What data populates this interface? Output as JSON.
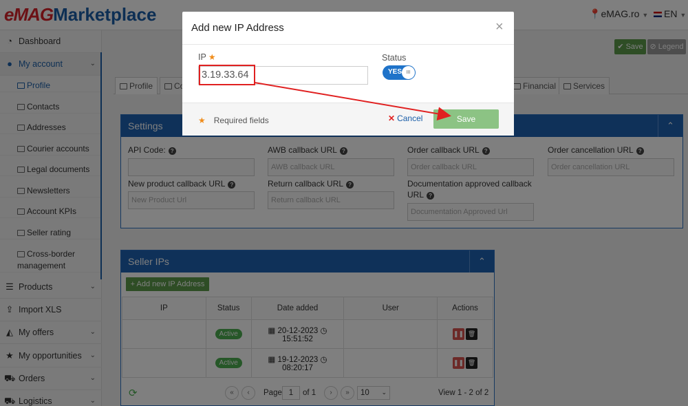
{
  "header": {
    "logo_brand": "eMAG",
    "logo_suffix": "Marketplace",
    "domain": "eMAG.ro",
    "language": "EN"
  },
  "sidebar": {
    "dashboard": "Dashboard",
    "my_account": "My account",
    "sub_items": [
      "Profile",
      "Contacts",
      "Addresses",
      "Courier accounts",
      "Legal documents",
      "Newsletters",
      "Account KPIs",
      "Seller rating",
      "Cross-border",
      "management"
    ],
    "products": "Products",
    "import_xls": "Import XLS",
    "my_offers": "My offers",
    "my_opportunities": "My opportunities",
    "orders": "Orders",
    "logistics": "Logistics"
  },
  "toolbar": {
    "save": "Save",
    "legend": "Legend"
  },
  "tabs": {
    "profile": "Profile",
    "co": "Co",
    "financial": "Financial",
    "services": "Services"
  },
  "settings": {
    "title": "Settings",
    "labels": {
      "api_code": "API Code:",
      "awb_callback": "AWB callback URL",
      "order_callback": "Order callback URL",
      "order_cancellation": "Order cancellation URL",
      "new_product_callback": "New product callback URL",
      "return_callback": "Return callback URL",
      "doc_approved_1": "Documentation approved callback",
      "doc_approved_2": "URL"
    },
    "placeholders": {
      "awb": "AWB callback URL",
      "order": "Order callback URL",
      "cancellation": "Order cancellation URL",
      "new_product": "New Product Url",
      "return": "Return callback URL",
      "doc_approved": "Documentation Approved Url"
    }
  },
  "seller_ips": {
    "title": "Seller IPs",
    "add_button": "+ Add new IP Address",
    "columns": [
      "IP",
      "Status",
      "Date added",
      "User",
      "Actions"
    ],
    "rows": [
      {
        "ip": "",
        "status": "Active",
        "date": "20-12-2023",
        "time": "15:51:52",
        "user": ""
      },
      {
        "ip": "",
        "status": "Active",
        "date": "19-12-2023",
        "time": "08:20:17",
        "user": ""
      }
    ],
    "pager": {
      "page_label": "Page",
      "page": "1",
      "of": "of 1",
      "per_page": "10",
      "summary": "View 1 - 2 of 2"
    }
  },
  "modal": {
    "title": "Add new IP Address",
    "close": "×",
    "ip_label": "IP",
    "ip_value": "3.19.33.64",
    "status_label": "Status",
    "toggle_label": "YES",
    "toggle_knob": "III",
    "required_note": "Required fields",
    "cancel": "Cancel",
    "save": "Save"
  },
  "colors": {
    "brand_blue": "#1f63b2",
    "brand_red": "#d8232a",
    "save_green": "#8cc384",
    "annotation_red": "#e02020"
  }
}
